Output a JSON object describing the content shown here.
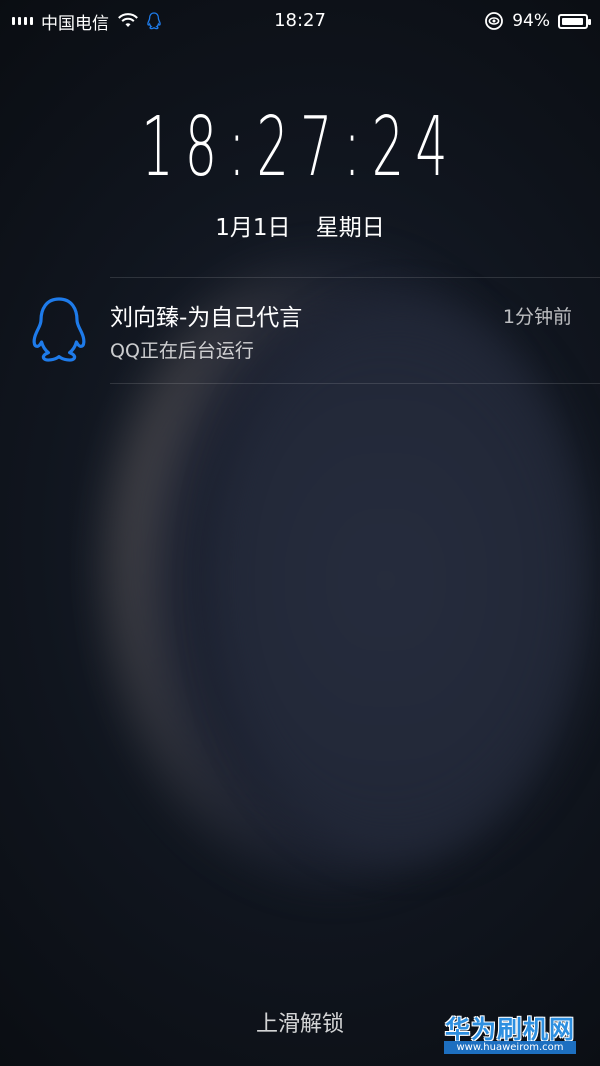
{
  "status_bar": {
    "carrier": "中国电信",
    "time": "18:27",
    "battery_text": "94%",
    "battery_level": 0.94,
    "icons": [
      "signal-icon",
      "wifi-icon",
      "qq-status-icon",
      "eye-care-icon",
      "battery-icon"
    ]
  },
  "lock_screen": {
    "clock": "18:27:24",
    "date": "1月1日",
    "weekday": "星期日",
    "unlock_hint": "上滑解锁"
  },
  "notification": {
    "app_icon": "qq-penguin-icon",
    "title": "刘向臻-为自己代言",
    "time": "1分钟前",
    "body": "QQ正在后台运行",
    "accent_color": "#1e7bea"
  },
  "watermark": {
    "text": "华为刷机网",
    "url": "www.huaweirom.com"
  }
}
